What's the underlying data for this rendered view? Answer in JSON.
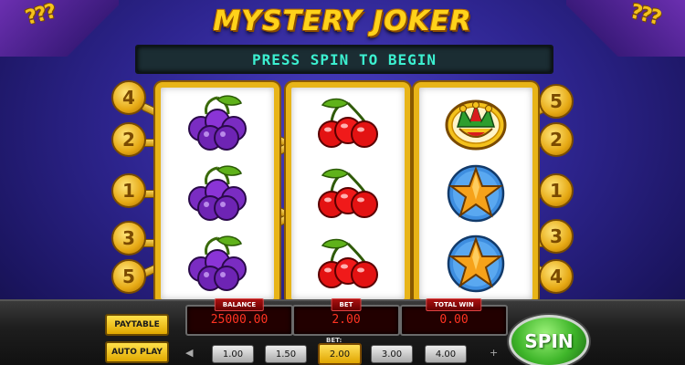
{
  "title": "MYSTERY JOKER",
  "message": "PRESS SPIN TO BEGIN",
  "reels": [
    {
      "symbols": [
        "plum-icon",
        "plum-icon",
        "plum-icon"
      ]
    },
    {
      "symbols": [
        "cherry-icon",
        "cherry-icon",
        "cherry-icon"
      ]
    },
    {
      "symbols": [
        "joker-icon",
        "star-icon",
        "star-icon"
      ]
    }
  ],
  "paylines": {
    "left": [
      "4",
      "2",
      "1",
      "3",
      "5"
    ],
    "right": [
      "5",
      "2",
      "1",
      "3",
      "4"
    ]
  },
  "meters": {
    "balance": {
      "label": "BALANCE",
      "value": "25000.00"
    },
    "bet": {
      "label": "BET",
      "value": "2.00"
    },
    "total_win": {
      "label": "TOTAL WIN",
      "value": "0.00"
    }
  },
  "buttons": {
    "paytable": "PAYTABLE",
    "autoplay": "AUTO PLAY",
    "spin": "SPIN"
  },
  "bet_selector": {
    "label": "BET:",
    "options": [
      "1.00",
      "1.50",
      "2.00",
      "3.00",
      "4.00"
    ],
    "selected": "2.00",
    "prev": "◀",
    "next": "+"
  },
  "colors": {
    "title_gold": "#ffd21a",
    "message_text": "#3cf0d0",
    "meter_text": "#ff3322",
    "spin_green": "#3fb62a"
  }
}
